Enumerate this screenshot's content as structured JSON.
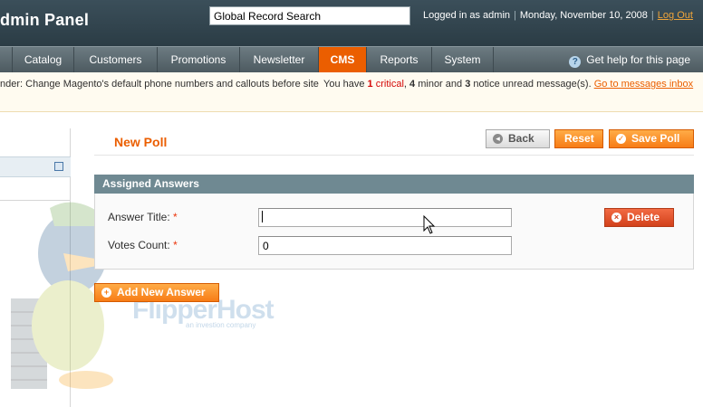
{
  "header": {
    "brand": "dmin Panel",
    "search_value": "Global Record Search",
    "logged_in": "Logged in as admin",
    "date": "Monday, November 10, 2008",
    "logout": "Log Out"
  },
  "nav": {
    "items": [
      "Catalog",
      "Customers",
      "Promotions",
      "Newsletter",
      "CMS",
      "Reports",
      "System"
    ],
    "active": "CMS",
    "help": "Get help for this page"
  },
  "notice": {
    "left": "nder: Change Magento's default phone numbers and callouts before site",
    "you_have": "You have",
    "critical_count": "1",
    "critical_label": "critical",
    "minor_count": "4",
    "minor_label": "minor and",
    "notice_count": "3",
    "notice_label": "notice unread message(s).",
    "link": "Go to messages inbox"
  },
  "page": {
    "title": "New Poll",
    "back": "Back",
    "reset": "Reset",
    "save": "Save Poll"
  },
  "answers": {
    "section_title": "Assigned Answers",
    "answer_title_label": "Answer Title:",
    "answer_title_value": "",
    "votes_label": "Votes Count:",
    "votes_value": "0",
    "required_mark": "*",
    "delete": "Delete",
    "add_new": "Add New Answer"
  },
  "watermark": {
    "brand": "FlipperHost",
    "tagline": "an investion company"
  },
  "colors": {
    "accent": "#eb5e00",
    "header": "#2b3c45",
    "section": "#6f8992"
  }
}
